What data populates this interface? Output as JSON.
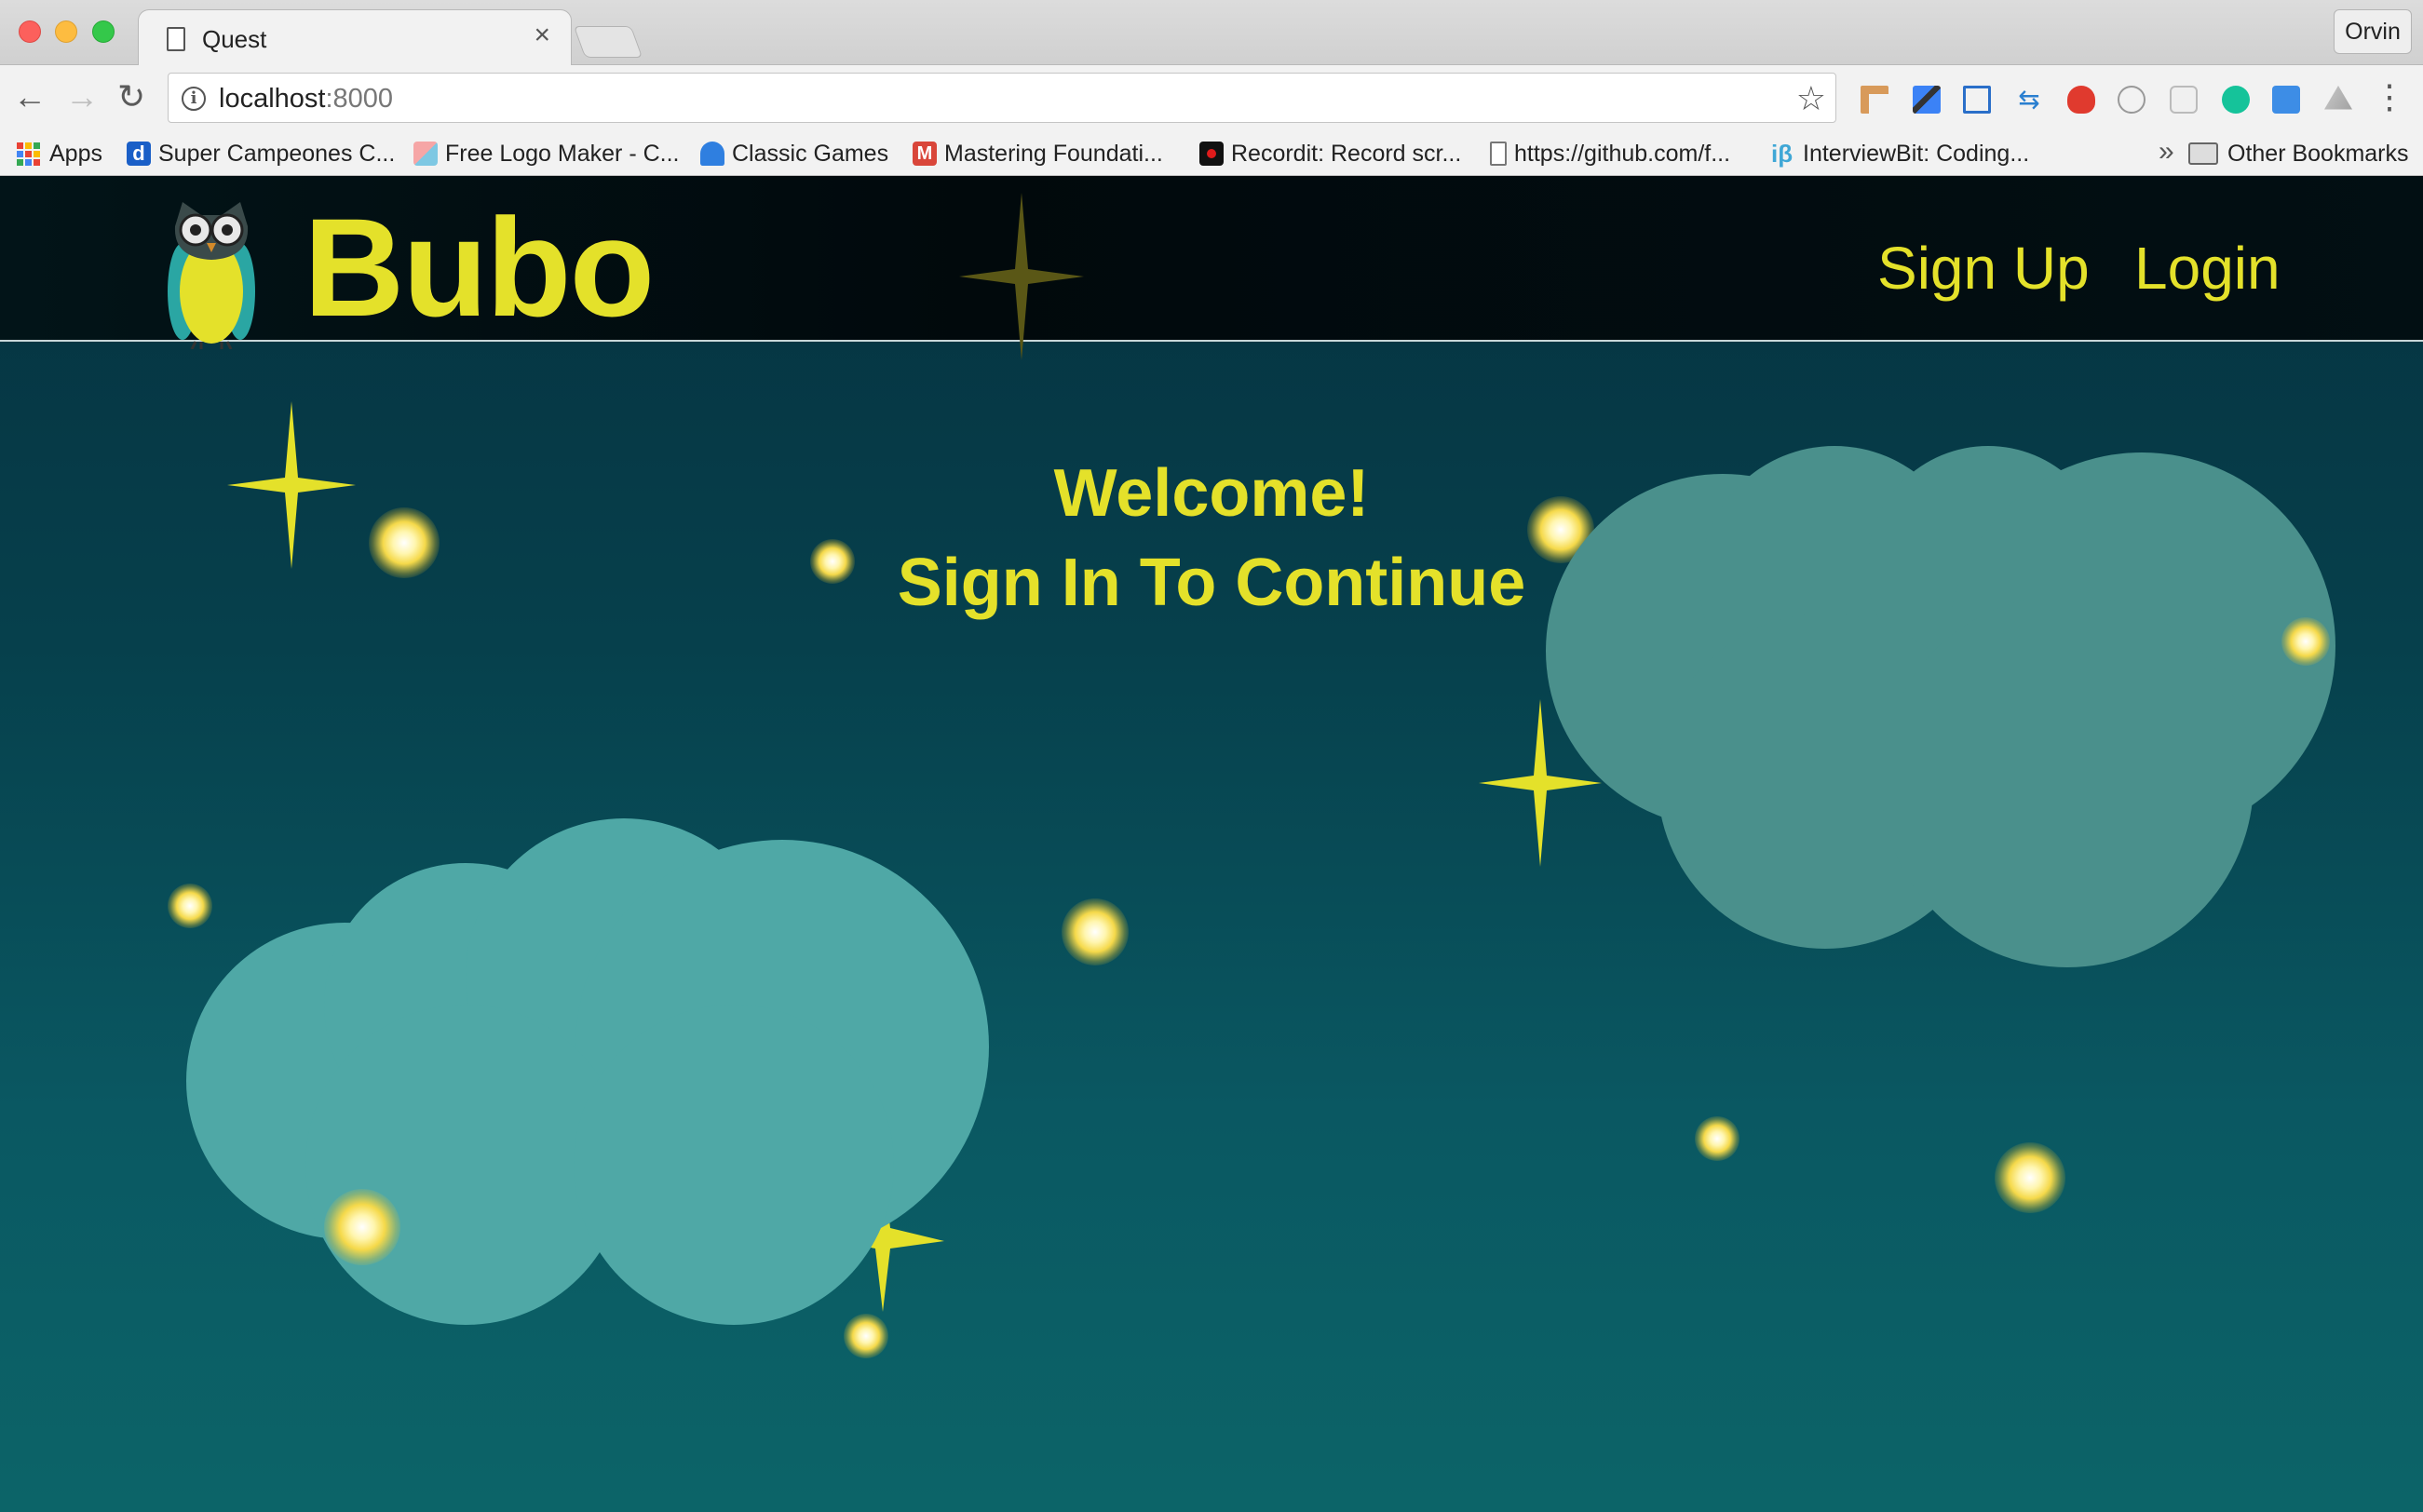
{
  "browser": {
    "tab_title": "Quest",
    "tab_close": "×",
    "profile_name": "Orvin",
    "url_host": "localhost",
    "url_port": ":8000",
    "nav": {
      "back": "←",
      "forward": "→",
      "reload": "↻"
    },
    "star_icon": "☆",
    "menu_icon": "⋮",
    "bookmarks": [
      {
        "label": "Apps"
      },
      {
        "label": "Super Campeones C..."
      },
      {
        "label": "Free Logo Maker - C..."
      },
      {
        "label": "Classic Games"
      },
      {
        "label": "Mastering Foundati..."
      },
      {
        "label": "Recordit: Record scr..."
      },
      {
        "label": "https://github.com/f..."
      },
      {
        "label": "InterviewBit: Coding..."
      }
    ],
    "bookmarks_overflow": "»",
    "other_bookmarks": "Other Bookmarks"
  },
  "site": {
    "brand": "Bubo",
    "nav": {
      "sign_up": "Sign Up",
      "login": "Login"
    },
    "welcome": "Welcome!",
    "prompt": "Sign In To Continue"
  },
  "colors": {
    "accent_yellow": "#e4e12a",
    "cloud": "#4fa8a6",
    "cloud_right": "#4a908c",
    "navbar": "#01090c"
  }
}
